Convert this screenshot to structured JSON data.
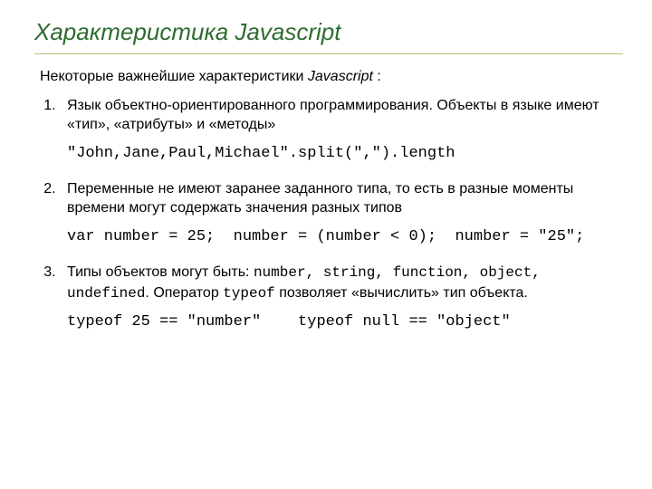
{
  "title": "Характеристика Javascript",
  "intro": {
    "prefix": "Некоторые важнейшие характеристики ",
    "italic": "Javascript",
    "suffix": " :"
  },
  "items": [
    {
      "text": "Язык объектно-ориентированного программирования. Объекты в языке имеют «тип», «атрибуты» и «методы»",
      "code": "\"John,Jane,Paul,Michael\".split(\",\").length"
    },
    {
      "text": "Переменные не имеют заранее заданного типа, то есть в разные моменты времени могут содержать значения разных типов",
      "code": "var number = 25;  number = (number < 0);  number = \"25\";"
    },
    {
      "p3": {
        "a": "Типы объектов могут быть: ",
        "types": "number, string, function, object, undefined",
        "b": ". Оператор ",
        "op": "typeof",
        "c": " позволяет «вычислить» тип объекта."
      },
      "code": "typeof 25 == \"number\"    typeof null == \"object\""
    }
  ]
}
